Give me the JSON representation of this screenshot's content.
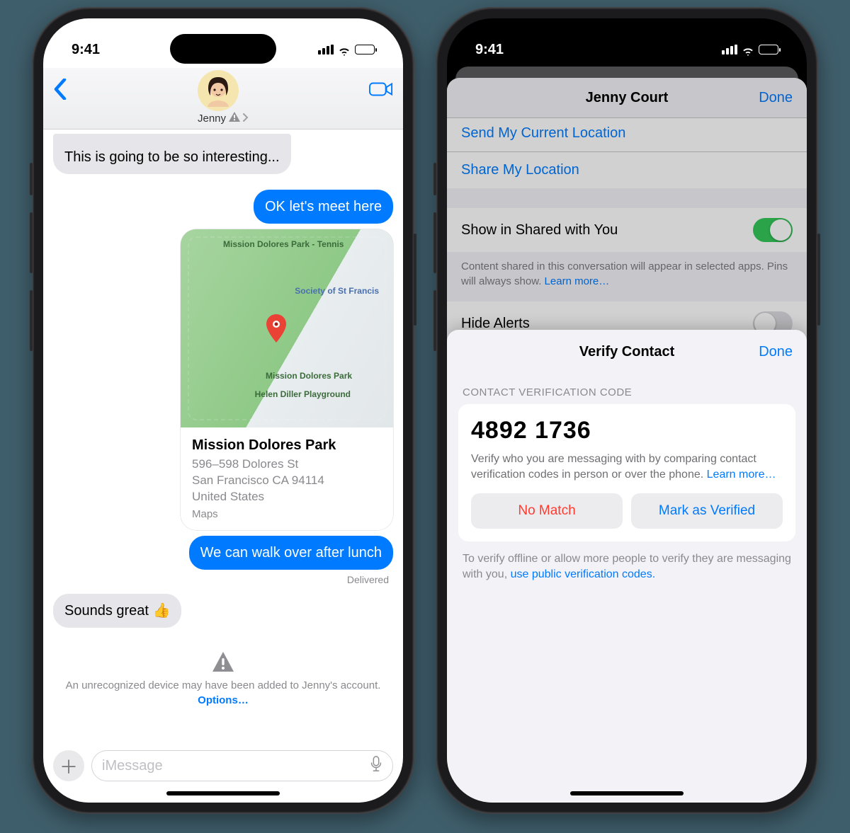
{
  "status": {
    "time": "9:41"
  },
  "messages": {
    "contact": "Jenny",
    "peek_bubble": "This is going to be so interesting...",
    "bubble_meet": "OK let's meet here",
    "map": {
      "label_tennis": "Mission Dolores\nPark - Tennis",
      "label_society": "Society of\nSt Francis",
      "label_center": "Mission\nDolores Park",
      "label_play": "Helen Diller\nPlayground",
      "title": "Mission Dolores Park",
      "addr1": "596–598 Dolores St",
      "addr2": "San Francisco CA 94114",
      "country": "United States",
      "app": "Maps"
    },
    "bubble_walk": "We can walk over after lunch",
    "delivered": "Delivered",
    "bubble_reply": "Sounds great 👍",
    "alert_text": "An unrecognized device may have been added to Jenny's account.",
    "alert_options": "Options…",
    "input_placeholder": "iMessage"
  },
  "details": {
    "contact_name": "Jenny Court",
    "done": "Done",
    "row_send_location": "Send My Current Location",
    "row_share_location": "Share My Location",
    "row_shared_with_you": "Show in Shared with You",
    "shared_footer_text": "Content shared in this conversation will appear in selected apps. Pins will always show. ",
    "shared_footer_link": "Learn more…",
    "row_hide_alerts": "Hide Alerts"
  },
  "verify": {
    "title": "Verify Contact",
    "done": "Done",
    "section": "CONTACT VERIFICATION CODE",
    "code": "4892 1736",
    "desc_text": "Verify who you are messaging with by comparing contact verification codes in person or over the phone. ",
    "desc_link": "Learn more…",
    "btn_nomatch": "No Match",
    "btn_verified": "Mark as Verified",
    "footer_text": "To verify offline or allow more people to verify they are messaging with you, ",
    "footer_link": "use public verification codes."
  }
}
